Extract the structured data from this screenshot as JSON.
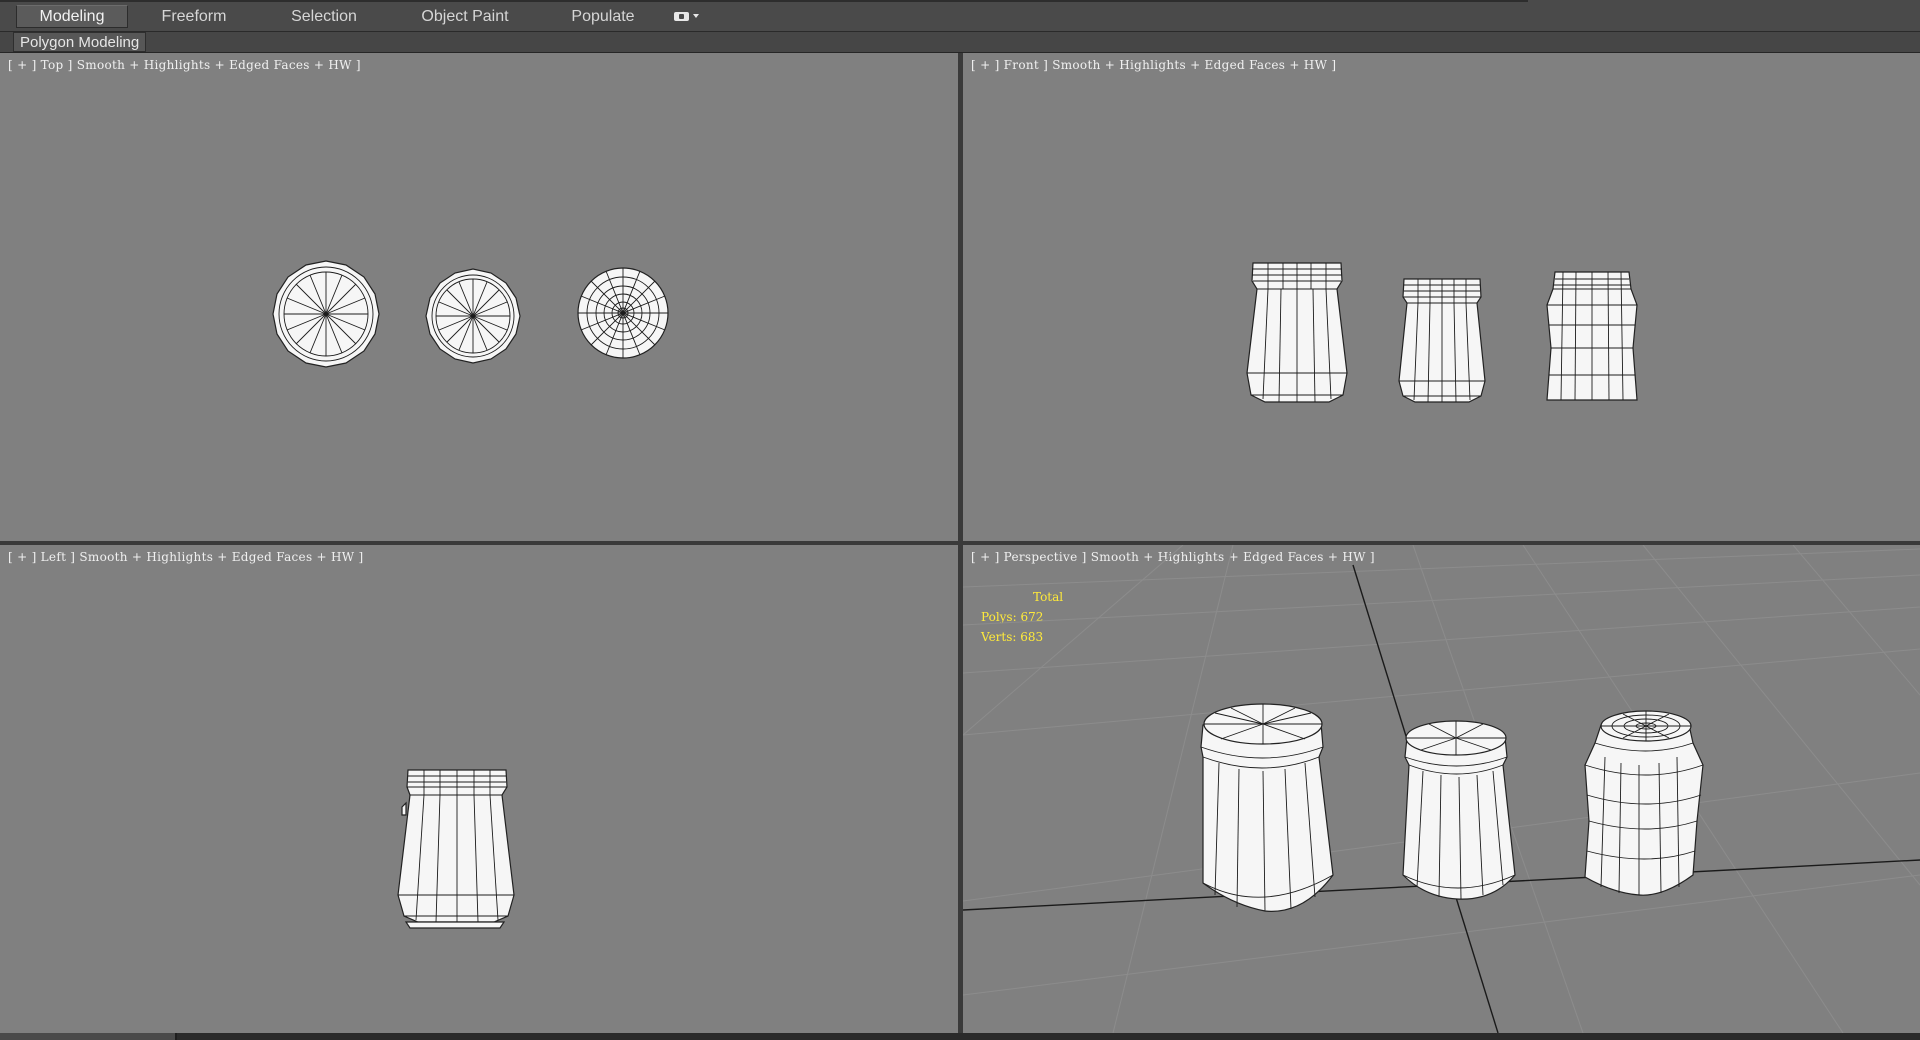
{
  "tabs": [
    {
      "label": "Modeling",
      "active": true
    },
    {
      "label": "Freeform",
      "active": false
    },
    {
      "label": "Selection",
      "active": false
    },
    {
      "label": "Object Paint",
      "active": false
    },
    {
      "label": "Populate",
      "active": false
    }
  ],
  "ribbon": {
    "label": "Polygon Modeling"
  },
  "viewports": {
    "top": {
      "label": "[ + ] Top ] Smooth + Highlights + Edged Faces + HW ]"
    },
    "front": {
      "label": "[ + ] Front ] Smooth + Highlights + Edged Faces + HW ]"
    },
    "left": {
      "label": "[ + ] Left ] Smooth + Highlights + Edged Faces + HW ]"
    },
    "perspective": {
      "label": "[ + ] Perspective ] Smooth + Highlights + Edged Faces + HW ]"
    }
  },
  "stats": {
    "total": "Total",
    "polys": "Polys: 672",
    "verts": "Verts: 683"
  },
  "colors": {
    "viewport_bg": "#808080",
    "stats_text": "#ffea3a",
    "ui_dark": "#3a3a3a"
  }
}
